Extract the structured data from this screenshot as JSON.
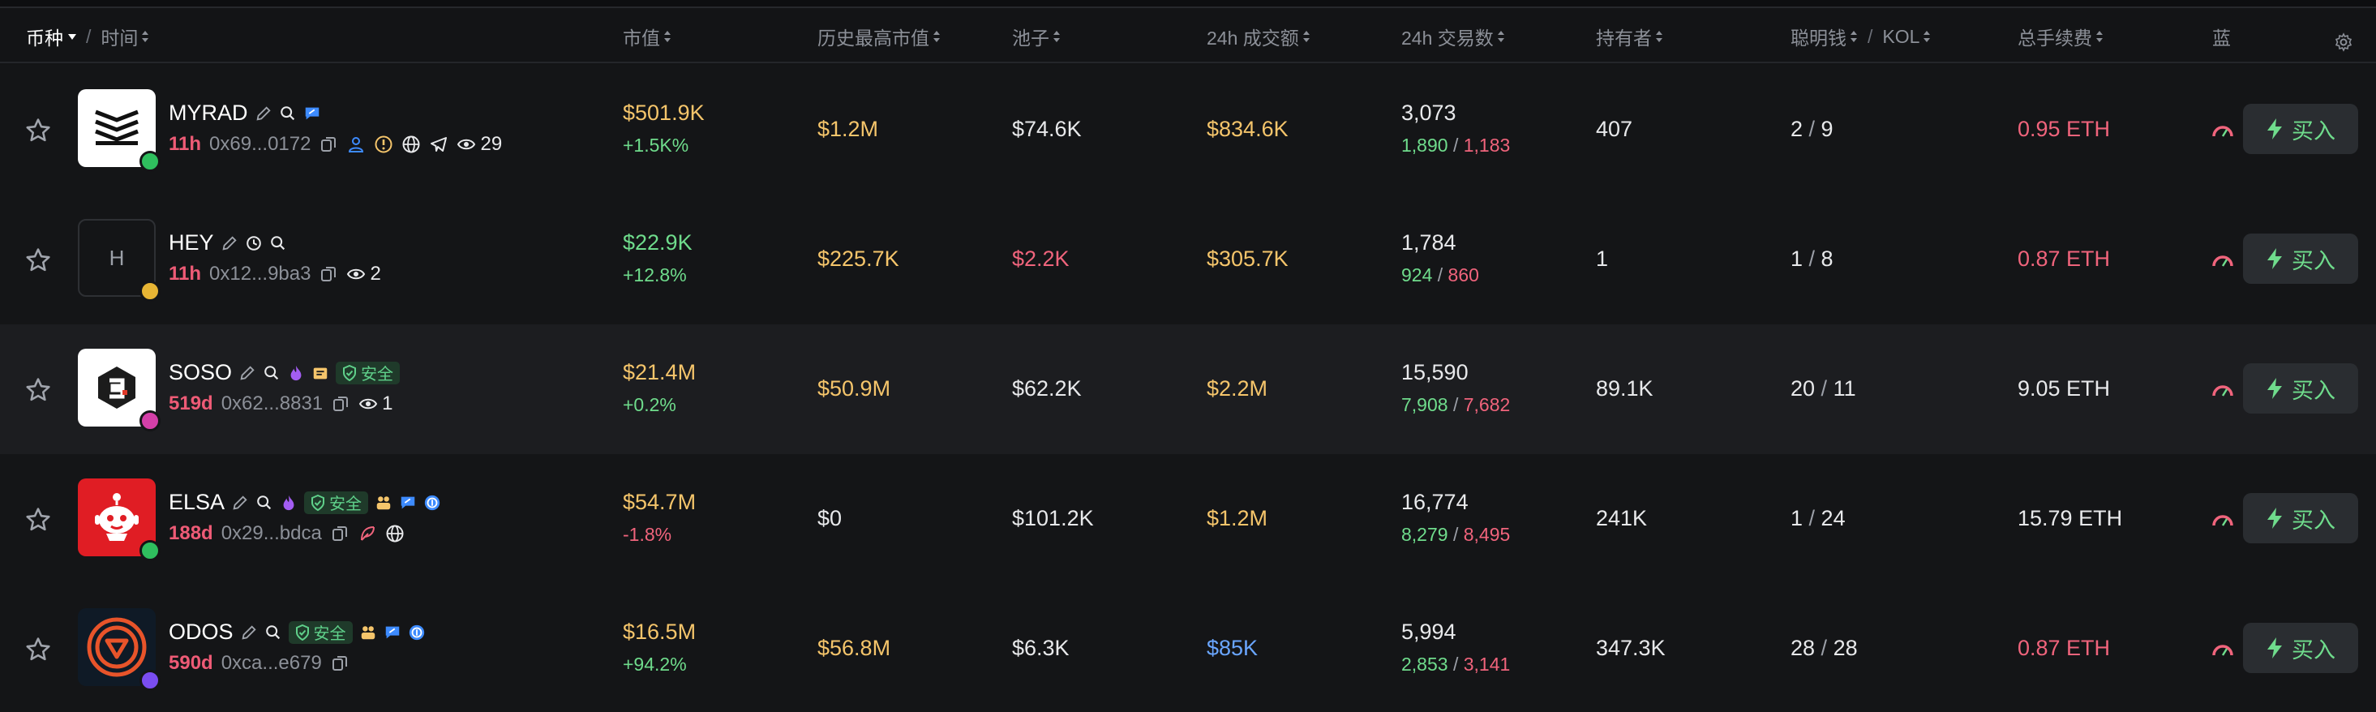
{
  "header": {
    "token_label": "币种",
    "time_label": "时间",
    "separator": "/",
    "market_cap": "市值",
    "ath_market_cap": "历史最高市值",
    "pool": "池子",
    "volume_24h": "24h 成交额",
    "txns_24h": "24h 交易数",
    "holders": "持有者",
    "smart_money": "聪明钱",
    "kol": "KOL",
    "total_fees": "总手续费",
    "blue_chip": "蓝"
  },
  "buy_label": "买入",
  "safe_label": "安全",
  "colors": {
    "background": "#131416",
    "row_alt": "#1c1d20",
    "gold": "#f5c56b",
    "green": "#6fdc8c",
    "red": "#f0647c",
    "blue": "#6aa6ff"
  },
  "rows": [
    {
      "name": "MYRAD",
      "logo_icon": "myrad-logo",
      "badge_color": "#2fbf5e",
      "age": "11h",
      "address": "0x69...0172",
      "views": "29",
      "name_icons": [
        "edit-icon",
        "search-icon",
        "chat-icon"
      ],
      "meta_icons": [
        "copy-icon",
        "user-icon",
        "warning-icon",
        "globe-icon",
        "telegram-icon",
        "eye-icon"
      ],
      "mcap": "$501.9K",
      "mcap_change": "+1.5K%",
      "mcap_change_dir": "up",
      "ath": "$1.2M",
      "pool": "$74.6K",
      "volume": "$834.6K",
      "txns": "3,073",
      "buys": "1,890",
      "sells": "1,183",
      "holders": "407",
      "smart": "2",
      "kol": "9",
      "fees": "0.95 ETH"
    },
    {
      "name": "HEY",
      "logo_text": "H",
      "badge_color": "#e7b534",
      "age": "11h",
      "address": "0x12...9ba3",
      "views": "2",
      "name_icons": [
        "edit-icon",
        "clock-icon",
        "search-icon"
      ],
      "meta_icons": [
        "copy-icon",
        "eye-icon"
      ],
      "mcap": "$22.9K",
      "mcap_change": "+12.8%",
      "mcap_change_dir": "up",
      "ath": "$225.7K",
      "pool": "$2.2K",
      "volume": "$305.7K",
      "txns": "1,784",
      "buys": "924",
      "sells": "860",
      "holders": "1",
      "smart": "1",
      "kol": "8",
      "fees": "0.87 ETH"
    },
    {
      "name": "SOSO",
      "logo_icon": "soso-logo",
      "badge_color": "#d43fa8",
      "age": "519d",
      "address": "0x62...8831",
      "views": "1",
      "name_icons": [
        "edit-icon",
        "search-icon",
        "flame-icon",
        "dev-icon"
      ],
      "meta_icons": [
        "copy-icon",
        "eye-icon"
      ],
      "mcap": "$21.4M",
      "mcap_change": "+0.2%",
      "mcap_change_dir": "up",
      "ath": "$50.9M",
      "pool": "$62.2K",
      "volume": "$2.2M",
      "txns": "15,590",
      "buys": "7,908",
      "sells": "7,682",
      "holders": "89.1K",
      "smart": "20",
      "kol": "11",
      "fees": "9.05 ETH"
    },
    {
      "name": "ELSA",
      "logo_icon": "elsa-logo",
      "badge_color": "#2fbf5e",
      "age": "188d",
      "address": "0x29...bdca",
      "views": "",
      "name_icons": [
        "edit-icon",
        "search-icon",
        "flame-icon",
        "holders-icon",
        "chat-icon",
        "coin-icon"
      ],
      "meta_icons": [
        "copy-icon",
        "feather-icon",
        "globe-icon"
      ],
      "mcap": "$54.7M",
      "mcap_change": "-1.8%",
      "mcap_change_dir": "down",
      "ath": "$0",
      "pool": "$101.2K",
      "volume": "$1.2M",
      "txns": "16,774",
      "buys": "8,279",
      "sells": "8,495",
      "holders": "241K",
      "smart": "1",
      "kol": "24",
      "fees": "15.79 ETH"
    },
    {
      "name": "ODOS",
      "logo_icon": "odos-logo",
      "badge_color": "#7a4df0",
      "age": "590d",
      "address": "0xca...e679",
      "views": "",
      "name_icons": [
        "edit-icon",
        "search-icon",
        "holders-icon",
        "chat-icon",
        "coin-icon"
      ],
      "meta_icons": [
        "copy-icon"
      ],
      "mcap": "$16.5M",
      "mcap_change": "+94.2%",
      "mcap_change_dir": "up",
      "ath": "$56.8M",
      "pool": "$6.3K",
      "volume": "$85K",
      "txns": "5,994",
      "buys": "2,853",
      "sells": "3,141",
      "holders": "347.3K",
      "smart": "28",
      "kol": "28",
      "fees": "0.87 ETH"
    }
  ]
}
